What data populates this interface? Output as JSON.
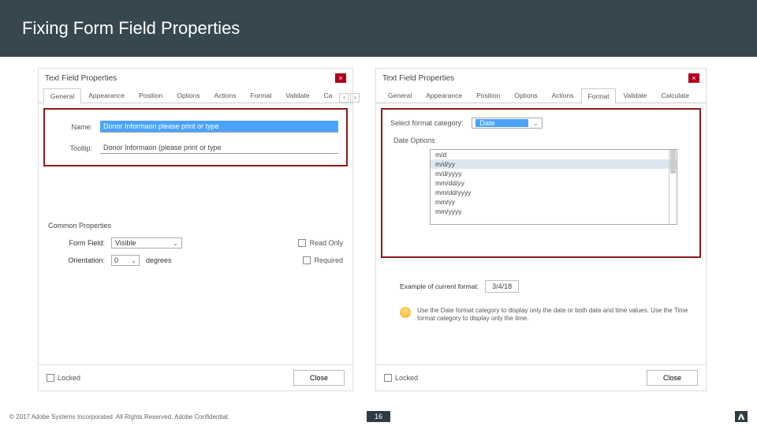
{
  "slide": {
    "title": "Fixing Form Field Properties",
    "page_number": "16",
    "copyright": "© 2017 Adobe Systems Incorporated.  All Rights Reserved.  Adobe Confidential."
  },
  "left": {
    "window_title": "Text Field Properties",
    "tabs": [
      "General",
      "Appearance",
      "Position",
      "Options",
      "Actions",
      "Format",
      "Validate",
      "Ca"
    ],
    "active_tab": 0,
    "name_label": "Name:",
    "name_value": "Donor Informaon please print or type",
    "tooltip_label": "Tooltip:",
    "tooltip_value": "Donor Informaon (please print or type",
    "common_title": "Common Properties",
    "form_field_label": "Form Field:",
    "form_field_value": "Visible",
    "readonly_label": "Read Only",
    "orientation_label": "Orientation:",
    "orientation_value": "0",
    "degrees": "degrees",
    "required_label": "Required",
    "locked_label": "Locked",
    "close_btn": "Close"
  },
  "right": {
    "window_title": "Text Field Properties",
    "tabs": [
      "General",
      "Appearance",
      "Position",
      "Options",
      "Actions",
      "Format",
      "Validate",
      "Calculate"
    ],
    "active_tab": 5,
    "select_category_label": "Select format category:",
    "category_value": "Date",
    "date_options_label": "Date Options",
    "list": [
      "m/d",
      "m/d/yy",
      "m/d/yyyy",
      "mm/dd/yy",
      "mm/dd/yyyy",
      "mm/yy",
      "mm/yyyy"
    ],
    "selected_index": 1,
    "example_label": "Example of current format:",
    "example_value": "3/4/18",
    "hint_text": "Use the Date format category to display only the date or both date and time values. Use the Time format category to display only the time.",
    "locked_label": "Locked",
    "close_btn": "Close"
  }
}
